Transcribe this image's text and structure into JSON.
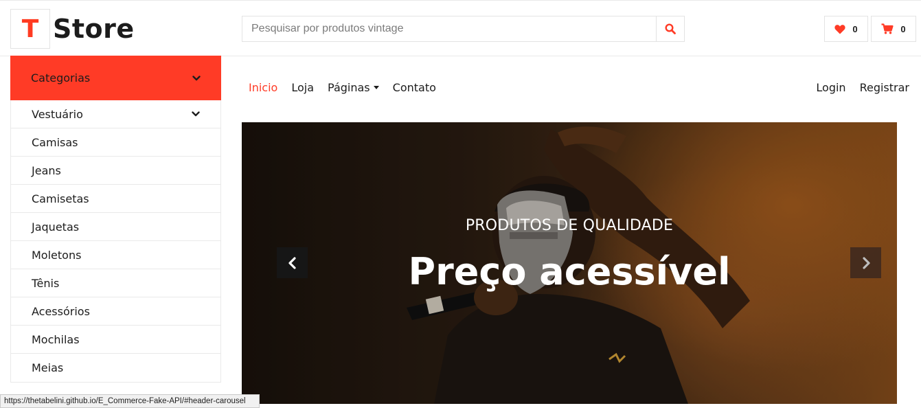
{
  "brand": {
    "logo_letter": "T",
    "name": "Store",
    "accent": "#ff3b26"
  },
  "search": {
    "placeholder": "Pesquisar por produtos vintage",
    "icon": "search-icon"
  },
  "wishlist": {
    "icon": "heart-icon",
    "count": "0"
  },
  "cart": {
    "icon": "cart-icon",
    "count": "0"
  },
  "sidebar": {
    "title": "Categorias",
    "items": [
      {
        "label": "Vestuário",
        "has_submenu": true
      },
      {
        "label": "Camisas"
      },
      {
        "label": "Jeans"
      },
      {
        "label": "Camisetas"
      },
      {
        "label": "Jaquetas"
      },
      {
        "label": "Moletons"
      },
      {
        "label": "Tênis"
      },
      {
        "label": "Acessórios"
      },
      {
        "label": "Mochilas"
      },
      {
        "label": "Meias"
      }
    ]
  },
  "nav": {
    "links": [
      {
        "label": "Inicio",
        "active": true
      },
      {
        "label": "Loja"
      },
      {
        "label": "Páginas",
        "dropdown": true
      },
      {
        "label": "Contato"
      }
    ],
    "right": [
      {
        "label": "Login"
      },
      {
        "label": "Registrar"
      }
    ]
  },
  "carousel": {
    "subtitle": "PRODUTOS DE QUALIDADE",
    "title": "Preço acessível",
    "prev_icon": "chevron-left-icon",
    "next_icon": "chevron-right-icon"
  },
  "status": {
    "url": "https://thetabelini.github.io/E_Commerce-Fake-API/#header-carousel"
  }
}
